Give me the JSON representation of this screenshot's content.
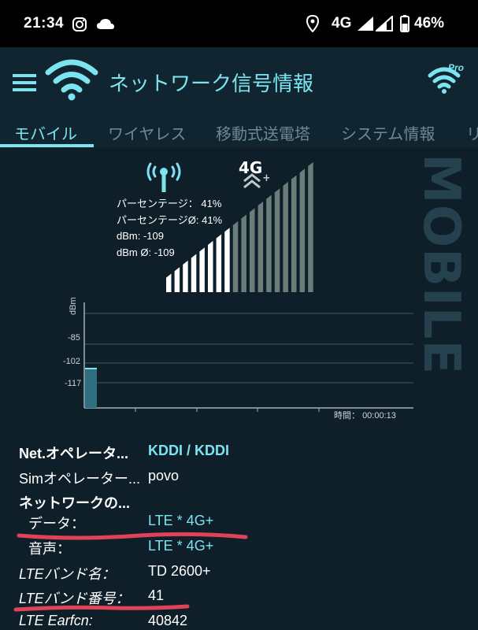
{
  "status_bar": {
    "time": "21:34",
    "network_type": "4G",
    "battery": "46%",
    "icons": [
      "instagram-icon",
      "cloud-icon",
      "location-icon",
      "signal-icon",
      "signal-icon-2",
      "battery-icon"
    ]
  },
  "app_bar": {
    "title": "ネットワーク信号情報",
    "menu_icon": "menu-icon",
    "logo_icon": "wifi-icon",
    "pro_badge": "Pro"
  },
  "tabs": [
    {
      "label": "モバイル",
      "active": true
    },
    {
      "label": "ワイヤレス",
      "active": false
    },
    {
      "label": "移動式送電塔",
      "active": false
    },
    {
      "label": "システム情報",
      "active": false
    },
    {
      "label": "リ",
      "active": false
    }
  ],
  "signal": {
    "network_badge": "4G",
    "percentage_label": "パーセンテージ：",
    "percentage_value": "41%",
    "percentage_avg_label": "パーセンテージØ:",
    "percentage_avg_value": "41%",
    "dbm_label": "dBm:",
    "dbm_value": "-109",
    "dbm_avg_label": "dBm Ø:",
    "dbm_avg_value": "-109",
    "bars_total": 18,
    "bars_active": 8,
    "watermark": "MOBILE"
  },
  "graph": {
    "y_unit": "dBm",
    "y_ticks": [
      "-85",
      "-102",
      "-117"
    ],
    "time_label": "時間：",
    "time_value": "00:00:13"
  },
  "info": {
    "operator_label": "Net.オペレータ...",
    "operator_value": "KDDI / KDDI",
    "sim_label": "Simオペレーター...",
    "sim_value": "povo",
    "network_label": "ネットワークの...",
    "data_label": "データ：",
    "data_value": "LTE * 4G+",
    "voice_label": "音声：",
    "voice_value": "LTE * 4G+",
    "band_name_label": "LTEバンド名：",
    "band_name_value": "TD 2600+",
    "band_number_label": "LTEバンド番号：",
    "band_number_value": "41",
    "earfcn_label": "LTE Earfcn:",
    "earfcn_value": "40842"
  },
  "colors": {
    "accent": "#7be4f0",
    "background": "#0f1f29",
    "annotation": "#e0425a"
  }
}
